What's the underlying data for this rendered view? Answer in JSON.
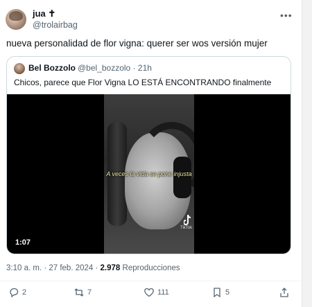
{
  "author": {
    "display_name": "jua ✝",
    "handle": "@trolairbag"
  },
  "more_icon": "more-dots-icon",
  "tweet_text": "nueva personalidad de flor vigna: querer ser wos versión mujer",
  "quote": {
    "name": "Bel Bozzolo",
    "handle": "@bel_bozzolo · 21h",
    "text": "Chicos, parece que Flor Vigna LO ESTÁ ENCONTRANDO finalmente",
    "video": {
      "subtitle": "A veces la vida se pone injusta",
      "duration": "1:07",
      "watermark": "TikTok"
    }
  },
  "meta": {
    "time_date": "3:10 a. m. · 27 feb. 2024 · ",
    "views_count": "2.978",
    "views_label": " Reproducciones"
  },
  "actions": [
    {
      "icon": "reply-icon",
      "count": "2"
    },
    {
      "icon": "retweet-icon",
      "count": "7"
    },
    {
      "icon": "like-icon",
      "count": "111"
    },
    {
      "icon": "bookmark-icon",
      "count": "5"
    },
    {
      "icon": "share-icon",
      "count": ""
    }
  ],
  "colors": {
    "text": "#0f1419",
    "secondary": "#536471",
    "border": "#cfd9de"
  }
}
